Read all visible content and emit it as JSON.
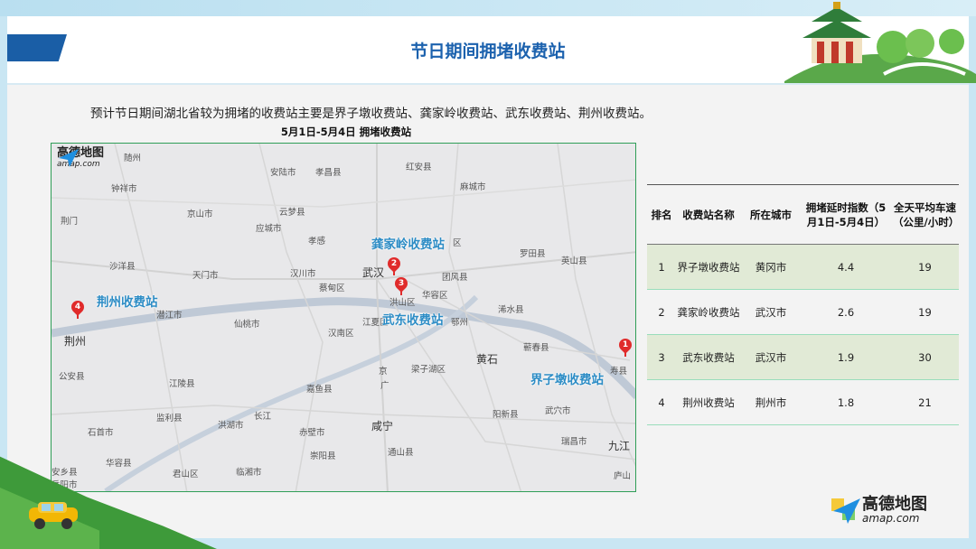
{
  "title": "节日期间拥堵收费站",
  "intro": "预计节日期间湖北省较为拥堵的收费站主要是界子墩收费站、龚家岭收费站、武东收费站、荆州收费站。",
  "map": {
    "caption": "5月1日-5月4日  拥堵收费站",
    "logo": {
      "name": "高德地图",
      "url": "amap.com"
    },
    "places": [
      "随州",
      "安陆市",
      "孝昌县",
      "红安县",
      "麻城市",
      "钟祥市",
      "京山市",
      "云梦县",
      "荆门",
      "应城市",
      "孝感",
      "区",
      "罗田县",
      "英山县",
      "沙洋县",
      "天门市",
      "汉川市",
      "武汉",
      "团风县",
      "蔡甸区",
      "洪山区",
      "华容区",
      "潜江市",
      "仙桃市",
      "江夏区",
      "鄂州",
      "浠水县",
      "荆州",
      "汉南区",
      "蕲春县",
      "黄石",
      "公安县",
      "江陵县",
      "嘉鱼县",
      "京",
      "广",
      "梁子湖区",
      "监利县",
      "洪湖市",
      "长江",
      "赤壁市",
      "咸宁",
      "阳新县",
      "武穴市",
      "石首市",
      "崇阳县",
      "通山县",
      "瑞昌市",
      "九江",
      "华容县",
      "岳阳市",
      "临湘市",
      "安乡县",
      "君山区",
      "庐山",
      "寿县"
    ],
    "stations": [
      {
        "num": "1",
        "label": "界子墩收费站"
      },
      {
        "num": "2",
        "label": "龚家岭收费站"
      },
      {
        "num": "3",
        "label": "武东收费站"
      },
      {
        "num": "4",
        "label": "荆州收费站"
      }
    ]
  },
  "table": {
    "headers": [
      "排名",
      "收费站名称",
      "所在城市",
      "拥堵延时指数（5月1日-5月4日）",
      "全天平均车速（公里/小时）"
    ],
    "rows": [
      [
        "1",
        "界子墩收费站",
        "黄冈市",
        "4.4",
        "19"
      ],
      [
        "2",
        "龚家岭收费站",
        "武汉市",
        "2.6",
        "19"
      ],
      [
        "3",
        "武东收费站",
        "武汉市",
        "1.9",
        "30"
      ],
      [
        "4",
        "荆州收费站",
        "荆州市",
        "1.8",
        "21"
      ]
    ]
  },
  "footer_logo": {
    "name": "高德地图",
    "url": "amap.com"
  },
  "colors": {
    "title": "#1c62ae",
    "accent": "#1a5ea6",
    "station_label": "#2c8cc5",
    "marker": "#e02b2b",
    "map_border": "#2f9e57",
    "row_shade": "#e1ead6"
  }
}
